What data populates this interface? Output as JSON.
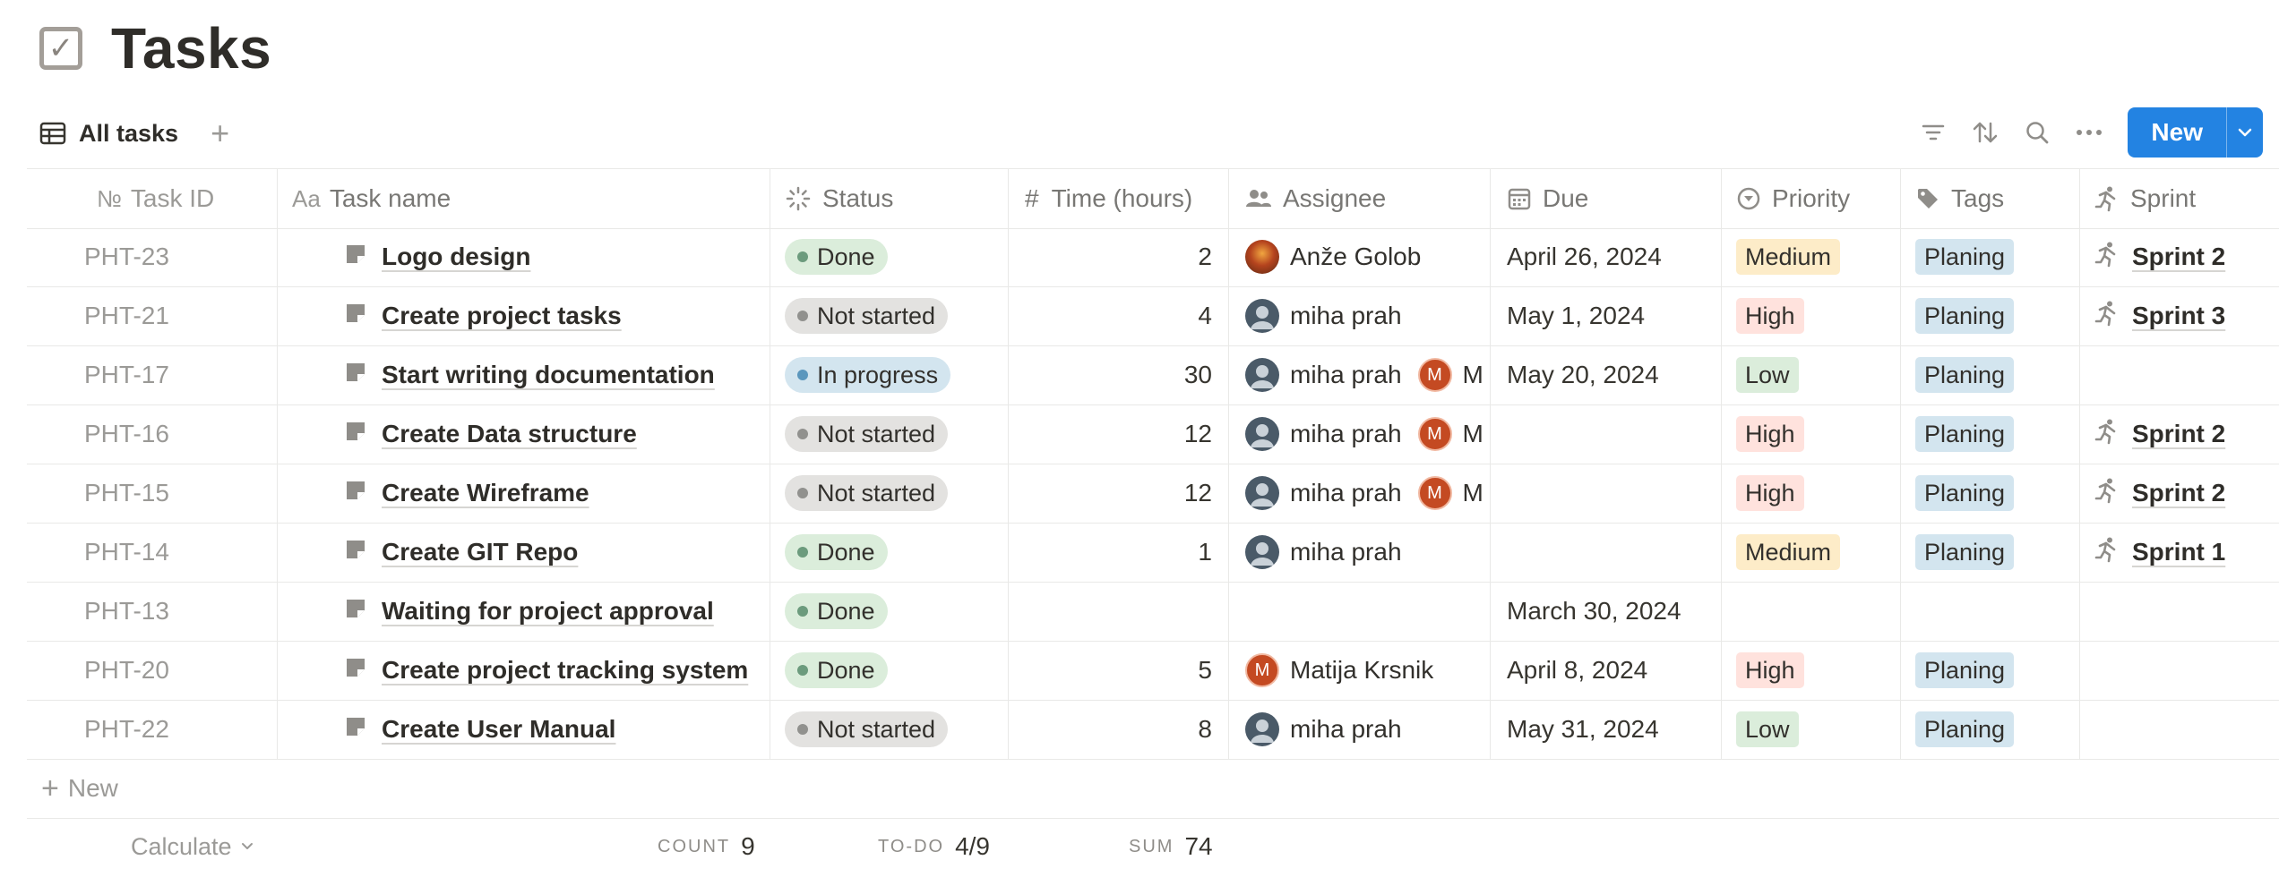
{
  "page": {
    "title": "Tasks",
    "icon": "checkbox-icon"
  },
  "view": {
    "tab_label": "All tasks",
    "add_view": "+"
  },
  "toolbar": {
    "new_label": "New",
    "icons": [
      "filter-icon",
      "sort-icon",
      "search-icon",
      "more-icon",
      "chevron-down-icon"
    ]
  },
  "columns": {
    "task_id": "Task ID",
    "task_name": "Task name",
    "status": "Status",
    "time": "Time (hours)",
    "assignee": "Assignee",
    "due": "Due",
    "priority": "Priority",
    "tags": "Tags",
    "sprint": "Sprint"
  },
  "column_icons": {
    "task_id": "№",
    "task_name": "Aa",
    "time": "#"
  },
  "status_styles": {
    "Done": {
      "bg": "#dbeddb",
      "dot": "#6c9b7d"
    },
    "Not started": {
      "bg": "#e3e2e0",
      "dot": "#91918e"
    },
    "In progress": {
      "bg": "#d3e5ef",
      "dot": "#5b97bd"
    }
  },
  "priority_styles": {
    "Medium": "#fdecc8",
    "High": "#ffe2dd",
    "Low": "#dbeddb"
  },
  "tag_color": "#d3e5ef",
  "rows": [
    {
      "id": "PHT-23",
      "name": "Logo design",
      "status": "Done",
      "time": "2",
      "assignee": "Anže Golob",
      "due": "April 26, 2024",
      "priority": "Medium",
      "tag": "Planing",
      "sprint": "Sprint 2"
    },
    {
      "id": "PHT-21",
      "name": "Create project tasks",
      "status": "Not started",
      "time": "4",
      "assignee": "miha prah",
      "due": "May 1, 2024",
      "priority": "High",
      "tag": "Planing",
      "sprint": "Sprint 3"
    },
    {
      "id": "PHT-17",
      "name": "Start writing documentation",
      "status": "In progress",
      "time": "30",
      "assignee": "miha prah",
      "assignee2": "M",
      "due": "May 20, 2024",
      "priority": "Low",
      "tag": "Planing",
      "sprint": ""
    },
    {
      "id": "PHT-16",
      "name": "Create Data structure",
      "status": "Not started",
      "time": "12",
      "assignee": "miha prah",
      "assignee2": "M",
      "due": "",
      "priority": "High",
      "tag": "Planing",
      "sprint": "Sprint 2"
    },
    {
      "id": "PHT-15",
      "name": "Create Wireframe",
      "status": "Not started",
      "time": "12",
      "assignee": "miha prah",
      "assignee2": "M",
      "due": "",
      "priority": "High",
      "tag": "Planing",
      "sprint": "Sprint 2"
    },
    {
      "id": "PHT-14",
      "name": "Create GIT Repo",
      "status": "Done",
      "time": "1",
      "assignee": "miha prah",
      "due": "",
      "priority": "Medium",
      "tag": "Planing",
      "sprint": "Sprint 1"
    },
    {
      "id": "PHT-13",
      "name": "Waiting for project approval",
      "status": "Done",
      "time": "",
      "assignee": "",
      "due": "March 30, 2024",
      "priority": "",
      "tag": "",
      "sprint": ""
    },
    {
      "id": "PHT-20",
      "name": "Create project tracking system",
      "status": "Done",
      "time": "5",
      "assignee": "Matija Krsnik",
      "due": "April 8, 2024",
      "priority": "High",
      "tag": "Planing",
      "sprint": ""
    },
    {
      "id": "PHT-22",
      "name": "Create User Manual",
      "status": "Not started",
      "time": "8",
      "assignee": "miha prah",
      "due": "May 31, 2024",
      "priority": "Low",
      "tag": "Planing",
      "sprint": ""
    }
  ],
  "footer": {
    "new_label": "New",
    "calculate_label": "Calculate",
    "count_label": "COUNT",
    "count_value": "9",
    "todo_label": "TO-DO",
    "todo_value": "4/9",
    "sum_label": "SUM",
    "sum_value": "74"
  }
}
